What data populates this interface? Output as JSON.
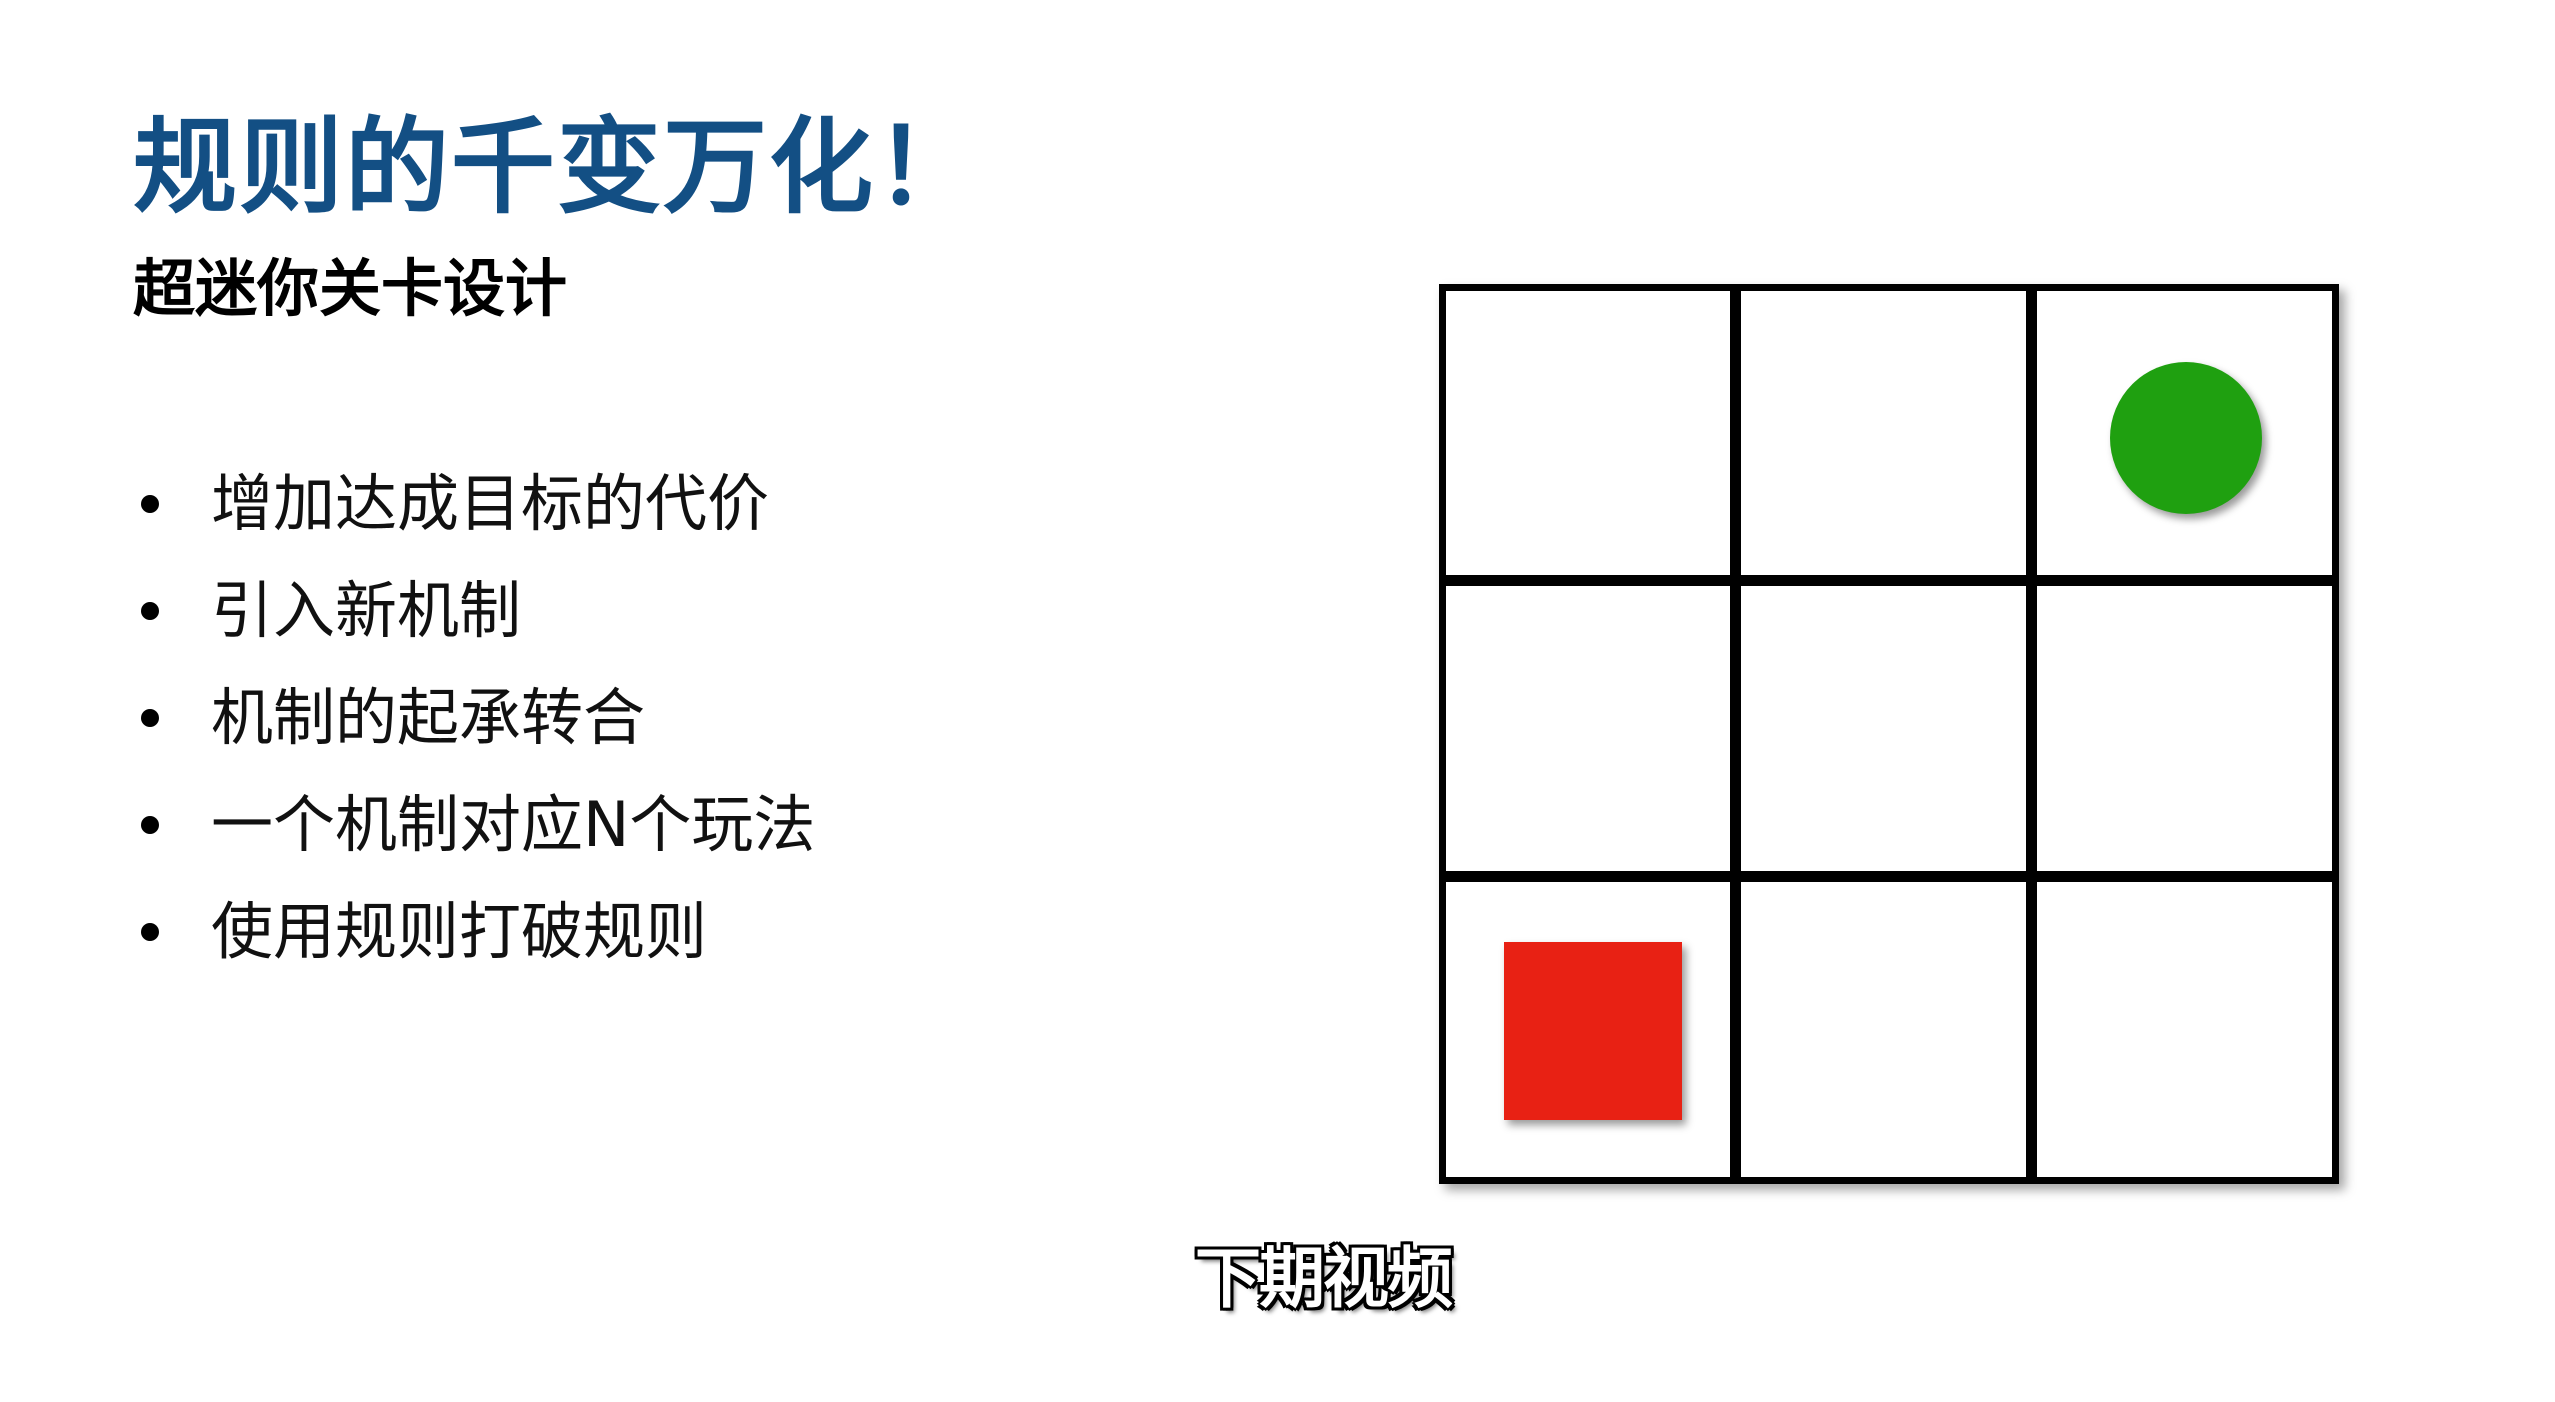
{
  "slide": {
    "title": "规则的千变万化！",
    "subtitle": "超迷你关卡设计",
    "bullets": [
      "增加达成目标的代价",
      "引入新机制",
      "机制的起承转合",
      "一个机制对应N个玩法",
      "使用规则打破规则"
    ]
  },
  "board": {
    "rows": 3,
    "cols": 3,
    "goal": {
      "row": 1,
      "col": 3,
      "shape": "circle",
      "color": "#1fa010"
    },
    "player": {
      "row": 3,
      "col": 1,
      "shape": "square",
      "color": "#e82114"
    }
  },
  "colors": {
    "title": "#134f84",
    "grid": "#000000"
  },
  "caption": {
    "text": "下期视频"
  }
}
